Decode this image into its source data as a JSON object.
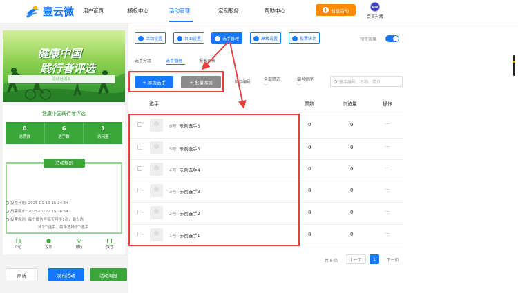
{
  "header": {
    "logo_text": "壹云微",
    "nav": [
      "用户首页",
      "模板中心",
      "活动管理",
      "定制服务",
      "帮助中心"
    ],
    "create_label": "创建活动",
    "vip_badge": "VIP",
    "vip_label": "会员升级"
  },
  "left": {
    "banner_line1": "健康中国",
    "banner_line2": "践行者评选",
    "card_title": "健康中国践行者评选",
    "stats": [
      {
        "value": "0",
        "label": "总票数"
      },
      {
        "value": "6",
        "label": "选手数"
      },
      {
        "value": "1",
        "label": "访问量"
      }
    ],
    "rules_title": "活动规则",
    "ended": "活动已结束",
    "vote_start": "投票开始: 2025-01-16 15:24:54",
    "vote_end": "投票截止: 2025-01-22 15:24:54",
    "vote_rule_1": "投票规则: 每个微信号每天可投1次，最少选",
    "vote_rule_2": "择1个选手，最多选择3个选手",
    "tabs": [
      "介绍",
      "投票",
      "排行",
      "报名"
    ],
    "buttons": {
      "refresh": "刷新",
      "publish": "发布活动",
      "poster": "活动海报"
    }
  },
  "toolbar": {
    "buttons": [
      "活动设置",
      "页面设置",
      "选手管理",
      "高级设置",
      "投票统计"
    ],
    "preview_label": "预览效果"
  },
  "subtabs": [
    "选手分组",
    "选手管理",
    "报名审核"
  ],
  "actions": {
    "add": "+ 添加选手",
    "bulk": "+ 批量添加",
    "show_number": "显示编号",
    "filter_all": "全部筛选",
    "sort": "编号倒序",
    "search_placeholder": "选手编号、名称、简介"
  },
  "table": {
    "headers": [
      "选手",
      "票数",
      "浏览量",
      "操作"
    ],
    "rows": [
      {
        "no": "6号",
        "name": "示例选手6",
        "votes": "0",
        "views": "0",
        "more": "···"
      },
      {
        "no": "5号",
        "name": "示例选手5",
        "votes": "0",
        "views": "0",
        "more": "···"
      },
      {
        "no": "4号",
        "name": "示例选手4",
        "votes": "0",
        "views": "0",
        "more": "···"
      },
      {
        "no": "3号",
        "name": "示例选手3",
        "votes": "0",
        "views": "0",
        "more": "···"
      },
      {
        "no": "2号",
        "name": "示例选手2",
        "votes": "0",
        "views": "0",
        "more": "···"
      },
      {
        "no": "1号",
        "name": "示例选手1",
        "votes": "0",
        "views": "0",
        "more": "···"
      }
    ]
  },
  "pagination": {
    "total": "共 6 条",
    "prev": "上一页",
    "current": "1",
    "next": "下一页"
  },
  "colors": {
    "primary": "#1677ff",
    "green": "#3aa63a",
    "orange": "#ff8a00",
    "annotation": "#e8413d"
  }
}
